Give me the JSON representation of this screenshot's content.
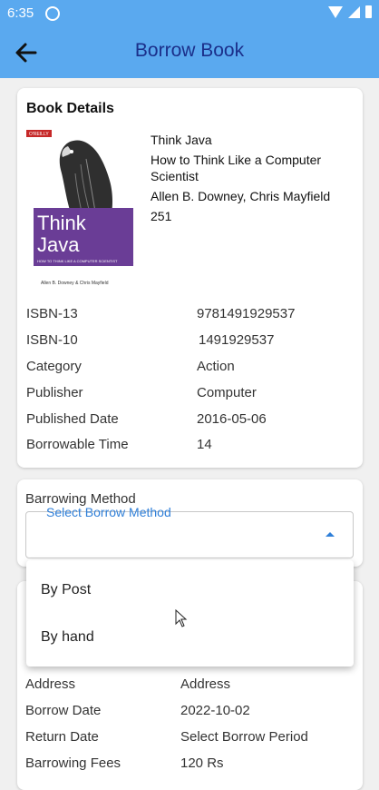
{
  "status_bar": {
    "time": "6:35"
  },
  "appbar": {
    "title": "Borrow Book"
  },
  "book_details": {
    "heading": "Book Details",
    "cover": {
      "publisher_mark": "O'REILLY",
      "title_line1": "Think",
      "title_line2": "Java",
      "subtitle": "HOW TO THINK LIKE A COMPUTER SCIENTIST",
      "authors": "Allen B. Downey & Chris Mayfield",
      "band_color": "#6a3d96"
    },
    "title": "Think Java",
    "subtitle": "How to Think Like a Computer Scientist",
    "authors": "Allen B. Downey, Chris Mayfield",
    "pages": "251",
    "rows": [
      {
        "key": "ISBN-13",
        "value": "9781491929537"
      },
      {
        "key": "ISBN-10",
        "value": "1491929537"
      },
      {
        "key": "Category",
        "value": "Action"
      },
      {
        "key": "Publisher",
        "value": "Computer"
      },
      {
        "key": "Published Date",
        "value": "2016-05-06"
      },
      {
        "key": "Borrowable Time",
        "value": "14"
      }
    ]
  },
  "borrowing_method": {
    "label": "Barrowing Method",
    "select_label": "Select Borrow Method",
    "options": [
      "By Post",
      "By hand"
    ]
  },
  "borrow_details": {
    "rows": [
      {
        "key": "Address",
        "value": "Address"
      },
      {
        "key": "Borrow Date",
        "value": "2022-10-02"
      },
      {
        "key": "Return Date",
        "value": "Select Borrow Period"
      },
      {
        "key": "Barrowing Fees",
        "value": "120 Rs"
      }
    ]
  },
  "colors": {
    "appbar": "#5aa9ef",
    "title": "#1b2f8a",
    "accent": "#2f7fd8"
  }
}
